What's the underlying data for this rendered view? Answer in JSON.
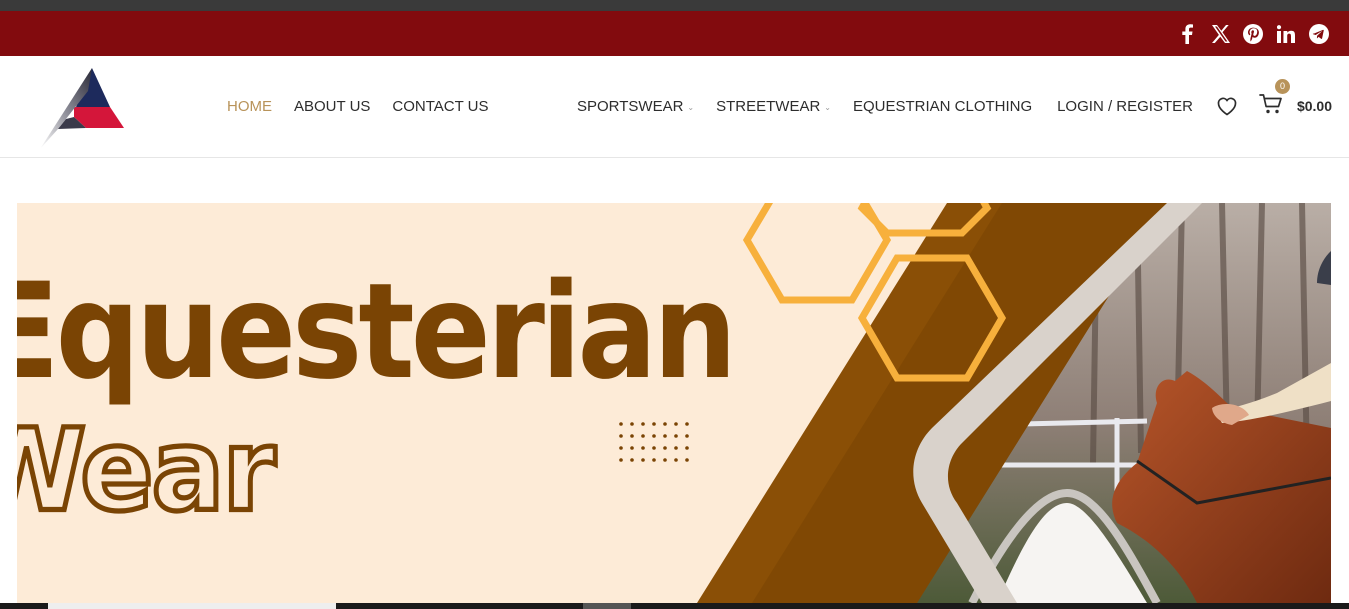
{
  "colors": {
    "topbar_bg": "#820b0e",
    "accent": "#b8935a",
    "banner_brown": "#7a4404",
    "banner_cream": "#fdebd7",
    "hexagon_orange": "#f7b03c"
  },
  "social": [
    {
      "icon": "facebook-icon"
    },
    {
      "icon": "x-twitter-icon"
    },
    {
      "icon": "pinterest-icon"
    },
    {
      "icon": "linkedin-icon"
    },
    {
      "icon": "telegram-icon"
    }
  ],
  "nav": {
    "home": "HOME",
    "about": "ABOUT US",
    "contact": "CONTACT US",
    "sportswear": "SPORTSWEAR",
    "streetwear": "STREETWEAR",
    "equestrian": "EQUESTRIAN CLOTHING",
    "active": "HOME"
  },
  "header": {
    "login_label": "LOGIN / REGISTER",
    "wishlist_icon": "heart-icon",
    "cart_icon": "cart-icon",
    "cart_count": "0",
    "cart_total": "$0.00"
  },
  "banner": {
    "title": "Equesterian",
    "subtitle": "Wear"
  }
}
